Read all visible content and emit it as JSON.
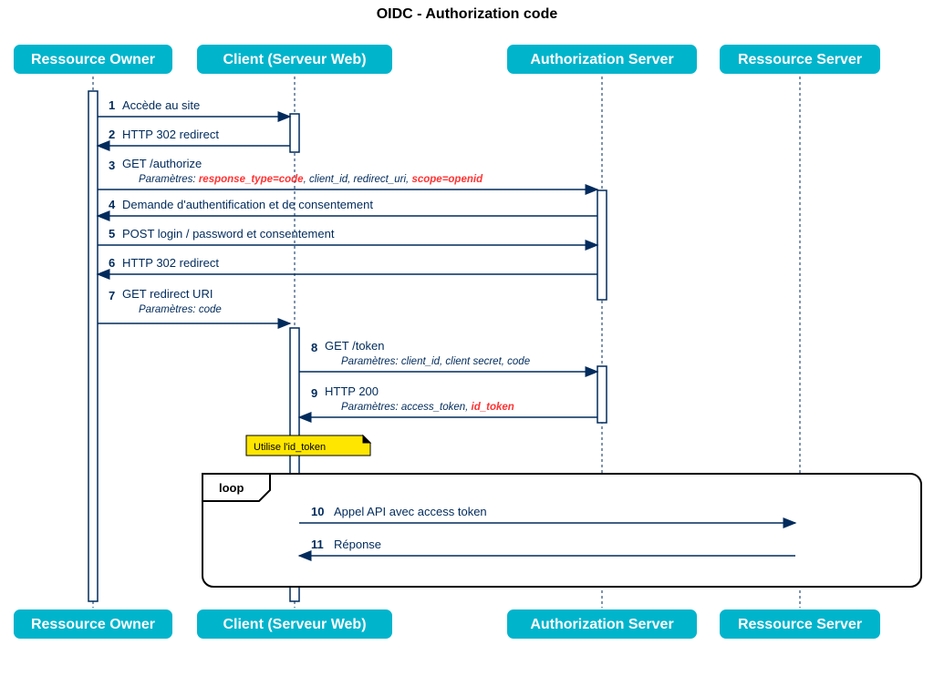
{
  "title": "OIDC - Authorization code",
  "participants": {
    "p1": "Ressource Owner",
    "p2": "Client (Serveur Web)",
    "p3": "Authorization Server",
    "p4": "Ressource Server"
  },
  "messages": {
    "m1": {
      "n": "1",
      "t": "Accède au site"
    },
    "m2": {
      "n": "2",
      "t": "HTTP 302 redirect"
    },
    "m3": {
      "n": "3",
      "t": "GET /authorize",
      "pl": "Paramètres: ",
      "p1": "response_type=code",
      "p2": ", client_id, redirect_uri, ",
      "p3": "scope=openid"
    },
    "m4": {
      "n": "4",
      "t": "Demande d'authentification et de consentement"
    },
    "m5": {
      "n": "5",
      "t": "POST login / password et consentement"
    },
    "m6": {
      "n": "6",
      "t": "HTTP 302 redirect"
    },
    "m7": {
      "n": "7",
      "t": "GET redirect URI",
      "p": "Paramètres: code"
    },
    "m8": {
      "n": "8",
      "t": "GET /token",
      "p": "Paramètres: client_id, client secret, code"
    },
    "m9": {
      "n": "9",
      "t": "HTTP 200",
      "pl": "Paramètres: access_token, ",
      "p1": "id_token"
    },
    "m10": {
      "n": "10",
      "t": "Appel API avec access token"
    },
    "m11": {
      "n": "11",
      "t": "Réponse"
    }
  },
  "note": "Utilise l'id_token",
  "loop": "loop",
  "chart_data": {
    "type": "sequence-diagram",
    "title": "OIDC - Authorization code",
    "participants": [
      "Ressource Owner",
      "Client (Serveur Web)",
      "Authorization Server",
      "Ressource Server"
    ],
    "steps": [
      {
        "n": 1,
        "from": "Ressource Owner",
        "to": "Client (Serveur Web)",
        "label": "Accède au site"
      },
      {
        "n": 2,
        "from": "Client (Serveur Web)",
        "to": "Ressource Owner",
        "label": "HTTP 302 redirect"
      },
      {
        "n": 3,
        "from": "Ressource Owner",
        "to": "Authorization Server",
        "label": "GET /authorize",
        "params": "response_type=code, client_id, redirect_uri, scope=openid"
      },
      {
        "n": 4,
        "from": "Authorization Server",
        "to": "Ressource Owner",
        "label": "Demande d'authentification et de consentement"
      },
      {
        "n": 5,
        "from": "Ressource Owner",
        "to": "Authorization Server",
        "label": "POST login / password et consentement"
      },
      {
        "n": 6,
        "from": "Authorization Server",
        "to": "Ressource Owner",
        "label": "HTTP 302 redirect"
      },
      {
        "n": 7,
        "from": "Ressource Owner",
        "to": "Client (Serveur Web)",
        "label": "GET redirect URI",
        "params": "code"
      },
      {
        "n": 8,
        "from": "Client (Serveur Web)",
        "to": "Authorization Server",
        "label": "GET /token",
        "params": "client_id, client secret, code"
      },
      {
        "n": 9,
        "from": "Authorization Server",
        "to": "Client (Serveur Web)",
        "label": "HTTP 200",
        "params": "access_token, id_token"
      },
      {
        "note": "Utilise l'id_token",
        "on": "Client (Serveur Web)"
      },
      {
        "loop_begin": true
      },
      {
        "n": 10,
        "from": "Client (Serveur Web)",
        "to": "Ressource Server",
        "label": "Appel API avec access token"
      },
      {
        "n": 11,
        "from": "Ressource Server",
        "to": "Client (Serveur Web)",
        "label": "Réponse"
      },
      {
        "loop_end": true
      }
    ]
  }
}
